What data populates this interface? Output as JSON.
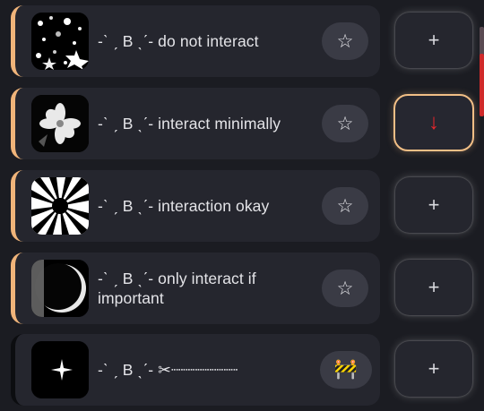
{
  "items": [
    {
      "label": "-ˋ ˏ B ˎˊ- do not interact",
      "star": "☆",
      "action": "+",
      "action_state": "default",
      "accent": "#f0b47a"
    },
    {
      "label": "-ˋ ˏ B ˎˊ- interact minimally",
      "star": "☆",
      "action": "↓",
      "action_state": "active",
      "accent": "#f0b47a"
    },
    {
      "label": "-ˋ ˏ B ˎˊ- interaction okay",
      "star": "☆",
      "action": "+",
      "action_state": "default",
      "accent": "#f0b47a"
    },
    {
      "label": "-ˋ ˏ B ˎˊ- only interact if important",
      "star": "☆",
      "action": "+",
      "action_state": "default",
      "accent": "#f0b47a"
    },
    {
      "label": "-ˋ ˏ B ˎˊ- ✂┈┈┈┈┈┈┈",
      "star": "🚧",
      "action": "+",
      "action_state": "default",
      "accent": "#0c0d10"
    }
  ],
  "colors": {
    "accent": "#f0b47a",
    "active_border": "#f2bf86",
    "down_arrow": "#e8262b",
    "background": "#1b1c22"
  }
}
